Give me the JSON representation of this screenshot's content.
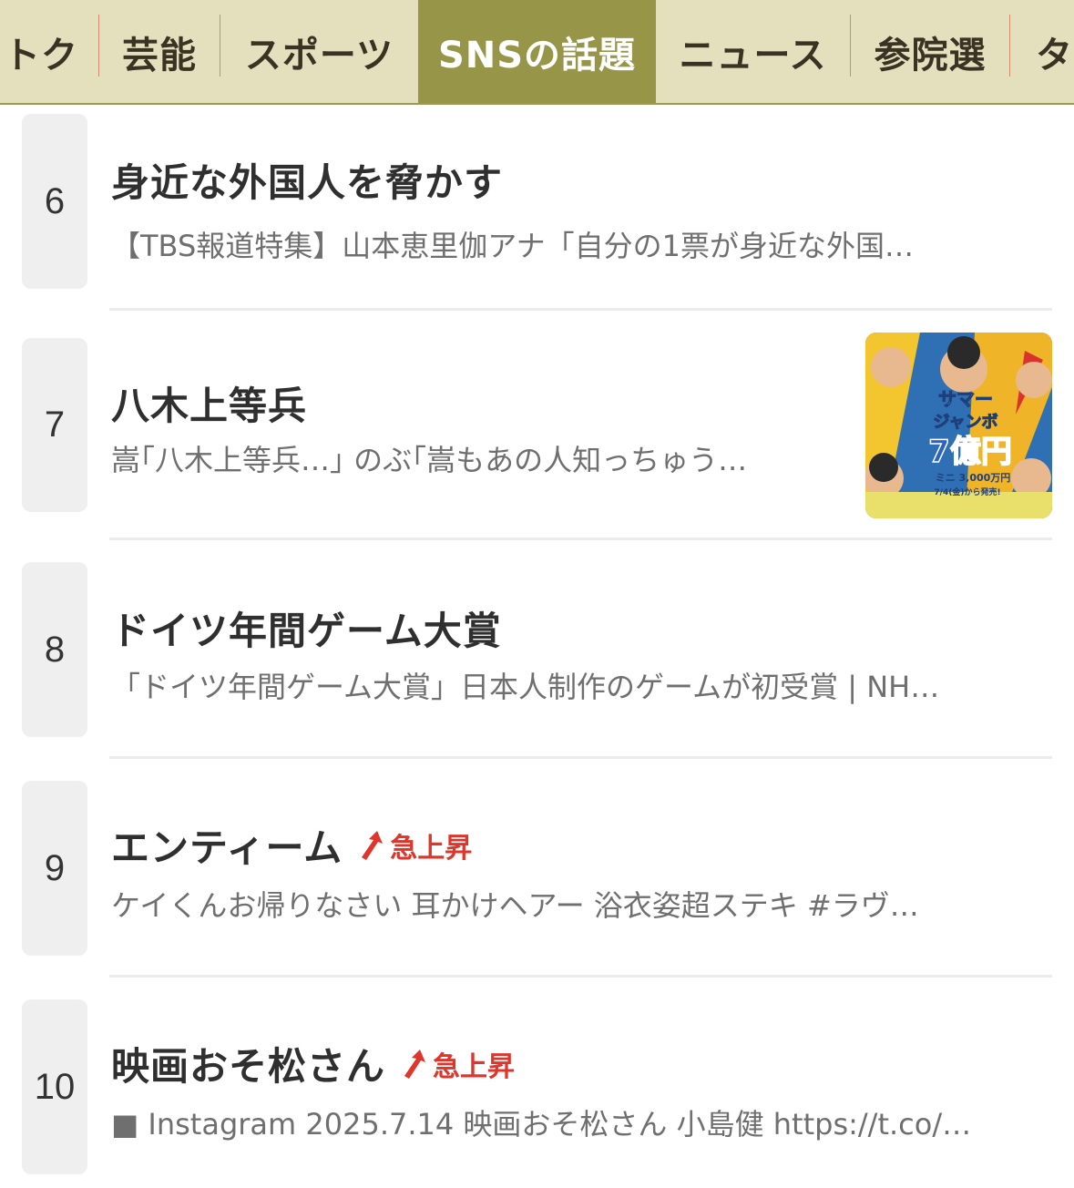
{
  "tabs": [
    {
      "label": "トク",
      "active": false
    },
    {
      "label": "芸能",
      "active": false
    },
    {
      "label": "スポーツ",
      "active": false
    },
    {
      "label": "SNSの話題",
      "active": true
    },
    {
      "label": "ニュース",
      "active": false
    },
    {
      "label": "参院選",
      "active": false
    },
    {
      "label": "タ",
      "active": false
    }
  ],
  "surge_label": "急上昇",
  "items": [
    {
      "rank": "6",
      "title": "身近な外国人を脅かす",
      "description": "【TBS報道特集】山本恵里伽アナ「自分の1票が身近な外国…",
      "surge": false
    },
    {
      "rank": "7",
      "title": "八木上等兵",
      "description": "嵩｢八木上等兵…｣ のぶ｢嵩もあの人知っちゅう…",
      "surge": false,
      "thumbnail": {
        "line1": "サマー",
        "line2": "ジャンボ",
        "line3": "7億円",
        "line4": "ミニ 3,000万円",
        "line5": "7/4(金)から発売!"
      }
    },
    {
      "rank": "8",
      "title": "ドイツ年間ゲーム大賞",
      "description": "「ドイツ年間ゲーム大賞」日本人制作のゲームが初受賞 | NH…",
      "surge": false
    },
    {
      "rank": "9",
      "title": "エンティーム",
      "description": "ケイくんお帰りなさい 耳かけヘアー 浴衣姿超ステキ #ラヴ…",
      "surge": true
    },
    {
      "rank": "10",
      "title": "映画おそ松さん",
      "description": "■ Instagram 2025.7.14 映画おそ松さん 小島健 https://t.co/…",
      "surge": true
    }
  ],
  "colors": {
    "tab_bg": "#e4dfbd",
    "tab_active": "#979548",
    "surge": "#e0352b",
    "rank_bg": "#efefef"
  }
}
